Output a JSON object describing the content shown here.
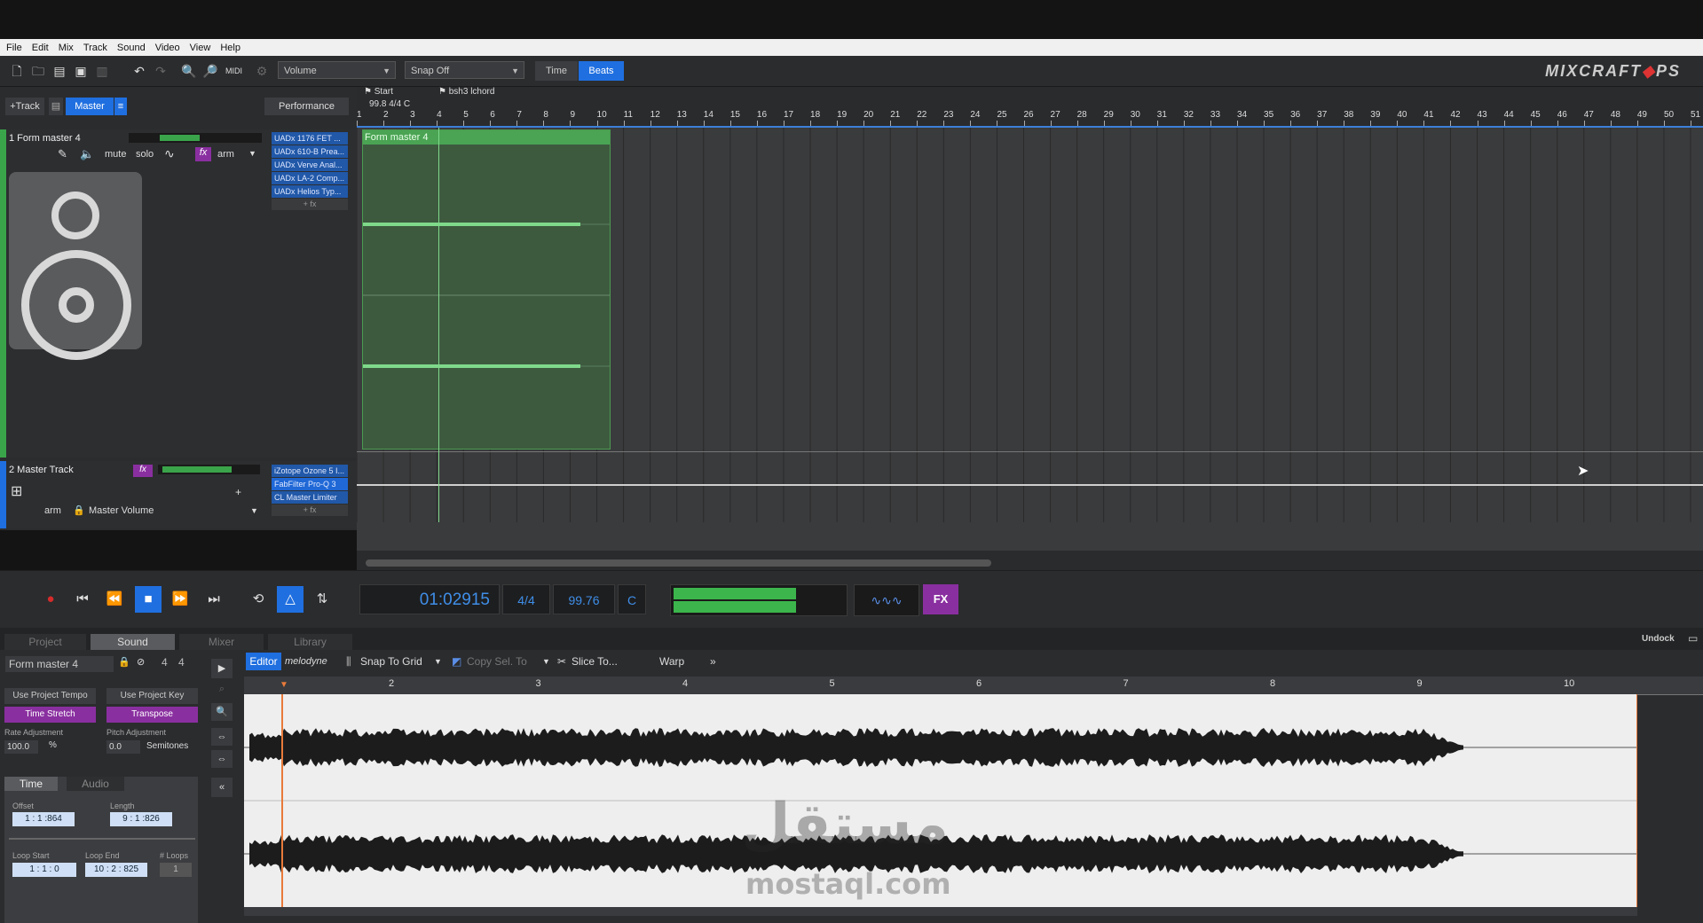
{
  "menu": [
    "File",
    "Edit",
    "Mix",
    "Track",
    "Sound",
    "Video",
    "View",
    "Help"
  ],
  "toolbar": {
    "volume_combo": "Volume",
    "snap_combo": "Snap Off",
    "time_tab": "Time",
    "beats_tab": "Beats",
    "logo_main": "MIXCRAFT",
    "logo_suffix": "PS"
  },
  "tracks_header": {
    "add_track": "+Track",
    "master": "Master",
    "performance": "Performance"
  },
  "track1": {
    "name": "1 Form master 4",
    "buttons": [
      "mute",
      "solo",
      "fx",
      "arm"
    ],
    "fx_slots": [
      "UADx 1176 FET ...",
      "UADx 610-B Prea...",
      "UADx Verve Anal...",
      "UADx LA-2 Comp...",
      "UADx Helios Typ..."
    ],
    "fx_add": "+ fx",
    "clip_name": "Form master 4"
  },
  "track2": {
    "name": "2 Master Track",
    "fx_label": "fx",
    "fx_slots": [
      "iZotope Ozone 5 I...",
      "FabFilter Pro-Q 3",
      "CL Master Limiter"
    ],
    "fx_add": "+ fx",
    "arm": "arm",
    "automation": "Master Volume"
  },
  "ruler": {
    "bars": [
      "1",
      "2",
      "3",
      "4",
      "5",
      "6",
      "7",
      "8",
      "9",
      "10",
      "11",
      "12",
      "13",
      "14",
      "15",
      "16",
      "17",
      "18",
      "19",
      "20",
      "21",
      "22",
      "23",
      "24",
      "25",
      "26",
      "27",
      "28",
      "29",
      "30",
      "31",
      "32",
      "33",
      "34",
      "35",
      "36",
      "37",
      "38",
      "39",
      "40",
      "41",
      "42",
      "43",
      "44",
      "45",
      "46",
      "47",
      "48",
      "49",
      "50",
      "51"
    ],
    "marker_start": "Start",
    "marker_start_info": "99.8 4/4 C",
    "marker_chord": "bsh3 lchord"
  },
  "transport": {
    "time": "01:02915",
    "signature": "4/4",
    "tempo": "99.76",
    "key": "C",
    "fx": "FX"
  },
  "bottom_tabs": [
    "Project",
    "Sound",
    "Mixer",
    "Library"
  ],
  "undock": "Undock",
  "sound_panel": {
    "clip_name": "Form master 4",
    "sig_top": "4",
    "sig_bottom": "4",
    "use_project_tempo": "Use Project Tempo",
    "use_project_key": "Use Project Key",
    "time_stretch": "Time Stretch",
    "transpose": "Transpose",
    "rate_label": "Rate Adjustment",
    "rate_value": "100.0",
    "rate_unit": "%",
    "pitch_label": "Pitch Adjustment",
    "pitch_value": "0.0",
    "pitch_unit": "Semitones",
    "tab_time": "Time",
    "tab_audio": "Audio",
    "offset_label": "Offset",
    "offset_value": "1 : 1 :864",
    "length_label": "Length",
    "length_value": "9 : 1 :826",
    "loop_start_label": "Loop Start",
    "loop_start_value": "1 : 1 : 0",
    "loop_end_label": "Loop End",
    "loop_end_value": "10 : 2 : 825",
    "loops_label": "# Loops",
    "loops_value": "1"
  },
  "editor": {
    "editor_tab": "Editor",
    "melodyne_tab": "melodyne",
    "snap": "Snap To Grid",
    "copy": "Copy Sel. To",
    "slice": "Slice To...",
    "warp": "Warp",
    "more": "»",
    "ruler_marks": [
      "2",
      "3",
      "4",
      "5",
      "6",
      "7",
      "8",
      "9",
      "10"
    ]
  },
  "watermark": {
    "arabic": "مستقل",
    "latin": "mostaql.com"
  }
}
